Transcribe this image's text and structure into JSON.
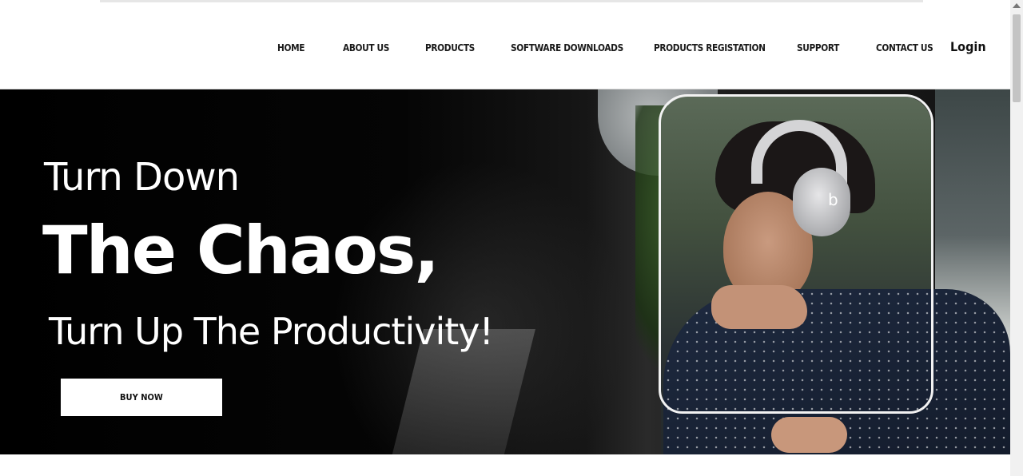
{
  "nav": {
    "items": [
      {
        "label": "HOME"
      },
      {
        "label": "ABOUT US"
      },
      {
        "label": "PRODUCTS"
      },
      {
        "label": "SOFTWARE DOWNLOADS"
      },
      {
        "label": "PRODUCTS REGISTATION"
      },
      {
        "label": "SUPPORT"
      },
      {
        "label": "CONTACT US"
      }
    ],
    "login_label": "Login"
  },
  "hero": {
    "line1": "Turn Down",
    "line2": "The Chaos,",
    "line3": "Turn Up The Productivity!",
    "button_label": "BUY NOW",
    "headphone_logo": "b"
  }
}
